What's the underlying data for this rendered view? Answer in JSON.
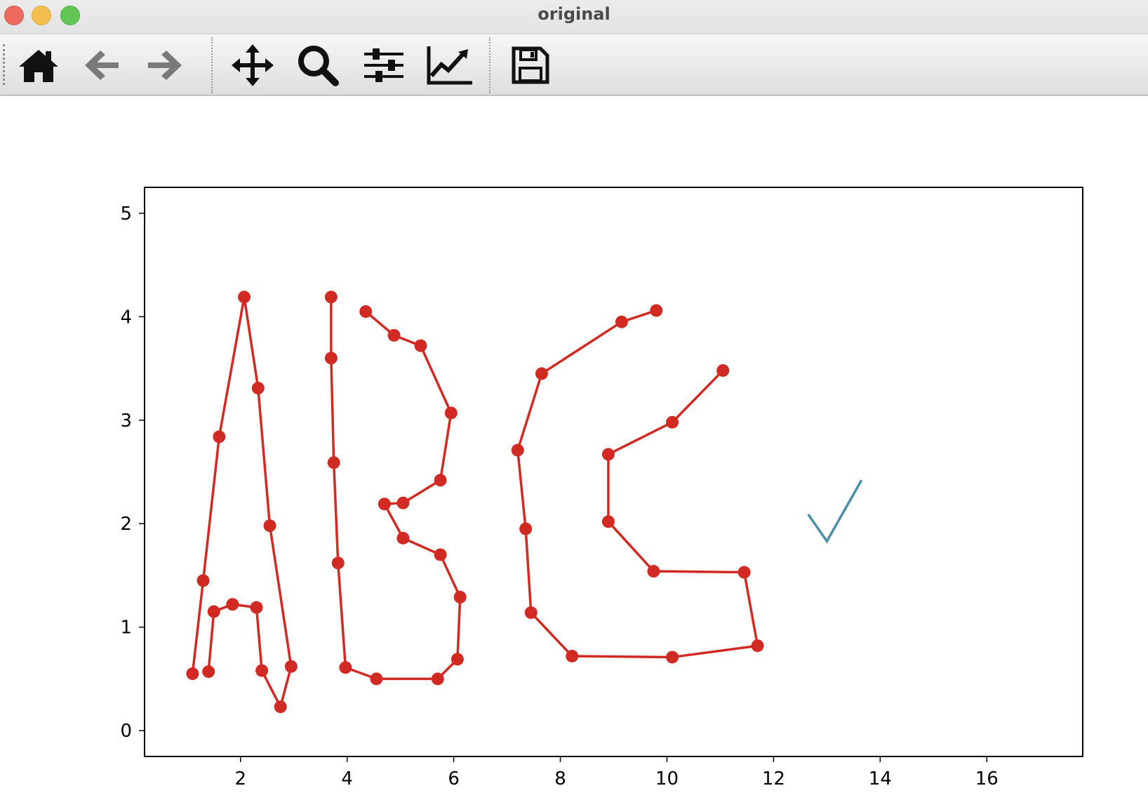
{
  "window": {
    "title": "original"
  },
  "toolbar": {
    "buttons": [
      {
        "name": "home",
        "icon": "home-icon"
      },
      {
        "name": "back",
        "icon": "arrow-left-icon"
      },
      {
        "name": "forward",
        "icon": "arrow-right-icon"
      },
      {
        "name": "pan",
        "icon": "move-arrows-icon"
      },
      {
        "name": "zoom",
        "icon": "magnifier-icon"
      },
      {
        "name": "configure-subplots",
        "icon": "sliders-icon"
      },
      {
        "name": "edit-axes",
        "icon": "line-chart-icon"
      },
      {
        "name": "save",
        "icon": "floppy-disk-icon"
      }
    ]
  },
  "chart_data": {
    "type": "line",
    "title": "",
    "xlabel": "",
    "ylabel": "",
    "xlim": [
      0.2,
      17.8
    ],
    "ylim": [
      -0.25,
      5.25
    ],
    "xticks": [
      2,
      4,
      6,
      8,
      10,
      12,
      14,
      16
    ],
    "yticks": [
      0,
      1,
      2,
      3,
      4,
      5
    ],
    "grid": false,
    "legend": "none",
    "line_color": "#d12a22",
    "marker": "circle",
    "series": [
      {
        "points": [
          [
            1.1,
            0.55
          ],
          [
            1.3,
            1.45
          ],
          [
            1.6,
            2.84
          ],
          [
            2.07,
            4.19
          ],
          [
            2.33,
            3.31
          ],
          [
            2.55,
            1.98
          ],
          [
            2.95,
            0.62
          ],
          [
            2.75,
            0.23
          ],
          [
            2.4,
            0.58
          ],
          [
            2.3,
            1.19
          ],
          [
            1.85,
            1.22
          ],
          [
            1.5,
            1.15
          ],
          [
            1.4,
            0.57
          ]
        ]
      },
      {
        "points": [
          [
            3.7,
            4.19
          ],
          [
            3.7,
            3.6
          ],
          [
            3.75,
            2.59
          ],
          [
            3.83,
            1.62
          ],
          [
            3.97,
            0.61
          ],
          [
            4.55,
            0.5
          ],
          [
            5.7,
            0.5
          ],
          [
            6.07,
            0.69
          ],
          [
            6.12,
            1.29
          ],
          [
            5.75,
            1.7
          ],
          [
            5.05,
            1.86
          ],
          [
            4.7,
            2.19
          ],
          [
            5.05,
            2.2
          ],
          [
            5.75,
            2.42
          ],
          [
            5.95,
            3.07
          ],
          [
            5.38,
            3.72
          ],
          [
            4.88,
            3.82
          ],
          [
            4.35,
            4.05
          ]
        ]
      },
      {
        "points": [
          [
            9.8,
            4.06
          ],
          [
            9.15,
            3.95
          ],
          [
            7.65,
            3.45
          ],
          [
            7.2,
            2.71
          ],
          [
            7.35,
            1.95
          ],
          [
            7.45,
            1.14
          ],
          [
            8.22,
            0.72
          ],
          [
            10.1,
            0.71
          ],
          [
            11.7,
            0.82
          ],
          [
            11.45,
            1.53
          ],
          [
            9.75,
            1.54
          ],
          [
            8.9,
            2.02
          ],
          [
            8.9,
            2.67
          ],
          [
            10.1,
            2.98
          ],
          [
            11.05,
            3.48
          ]
        ]
      }
    ],
    "annotation": {
      "type": "checkmark",
      "color": "#4a8fa6",
      "points": [
        [
          12.65,
          2.09
        ],
        [
          13.0,
          1.83
        ],
        [
          13.65,
          2.42
        ]
      ]
    }
  }
}
